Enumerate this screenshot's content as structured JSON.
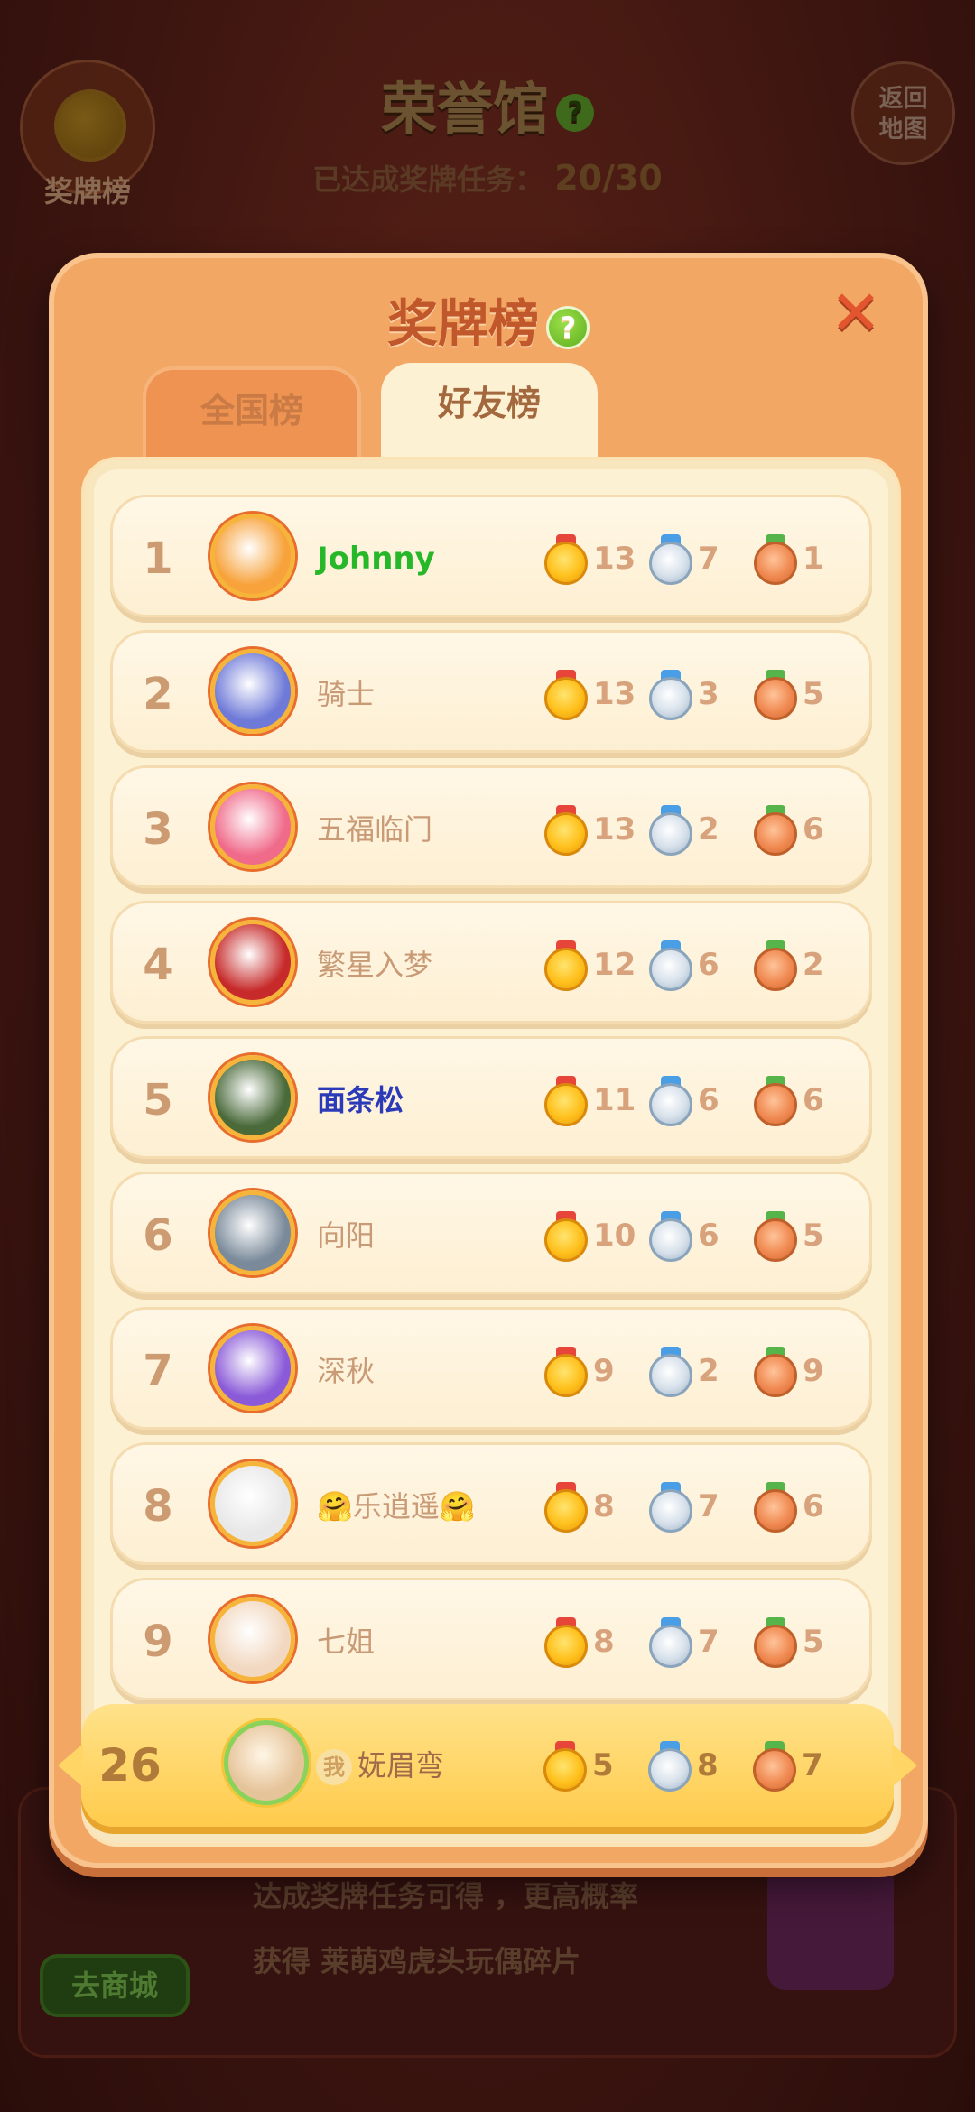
{
  "background": {
    "title": "荣誉馆",
    "help": "?",
    "medal_board_label": "奖牌榜",
    "return_label_line1": "返回",
    "return_label_line2": "地图",
    "progress_label": "已达成奖牌任务：",
    "progress_value": "20/30",
    "reward_line1": "达成奖牌任务可得 ，更高概率",
    "reward_line2": "获得 莱萌鸡虎头玩偶碎片",
    "shop_button": "去商城"
  },
  "modal": {
    "title": "奖牌榜",
    "help": "?",
    "close": "✕",
    "tabs": [
      {
        "label": "全国榜",
        "active": false
      },
      {
        "label": "好友榜",
        "active": true
      }
    ]
  },
  "leaderboard": [
    {
      "rank": "1",
      "name": "Johnny",
      "gold": "13",
      "silver": "7",
      "bronze": "1",
      "avatar_color": "#f7a23a"
    },
    {
      "rank": "2",
      "name": "骑士",
      "gold": "13",
      "silver": "3",
      "bronze": "5",
      "avatar_color": "#6f7ad8"
    },
    {
      "rank": "3",
      "name": "五福临门",
      "gold": "13",
      "silver": "2",
      "bronze": "6",
      "avatar_color": "#f06a8a"
    },
    {
      "rank": "4",
      "name": "繁星入梦",
      "gold": "12",
      "silver": "6",
      "bronze": "2",
      "avatar_color": "#c72a2a"
    },
    {
      "rank": "5",
      "name": "面条松",
      "gold": "11",
      "silver": "6",
      "bronze": "6",
      "avatar_color": "#4a6a3a"
    },
    {
      "rank": "6",
      "name": "向阳",
      "gold": "10",
      "silver": "6",
      "bronze": "5",
      "avatar_color": "#7a8a9a"
    },
    {
      "rank": "7",
      "name": "深秋",
      "gold": "9",
      "silver": "2",
      "bronze": "9",
      "avatar_color": "#8a5ad8"
    },
    {
      "rank": "8",
      "name": "🤗乐逍遥🤗",
      "gold": "8",
      "silver": "7",
      "bronze": "6",
      "avatar_color": "#e8e8e8"
    },
    {
      "rank": "9",
      "name": "七姐",
      "gold": "8",
      "silver": "7",
      "bronze": "5",
      "avatar_color": "#f2d8c0"
    }
  ],
  "me": {
    "rank": "26",
    "badge": "我",
    "name": "妩眉弯",
    "gold": "5",
    "silver": "8",
    "bronze": "7",
    "avatar_color": "#e6c49a"
  },
  "colors": {
    "modal_bg": "#f3a765",
    "title_color": "#c0582c",
    "panel_bg": "#fdf1d3",
    "me_row_bg": "#ffcb4c"
  }
}
